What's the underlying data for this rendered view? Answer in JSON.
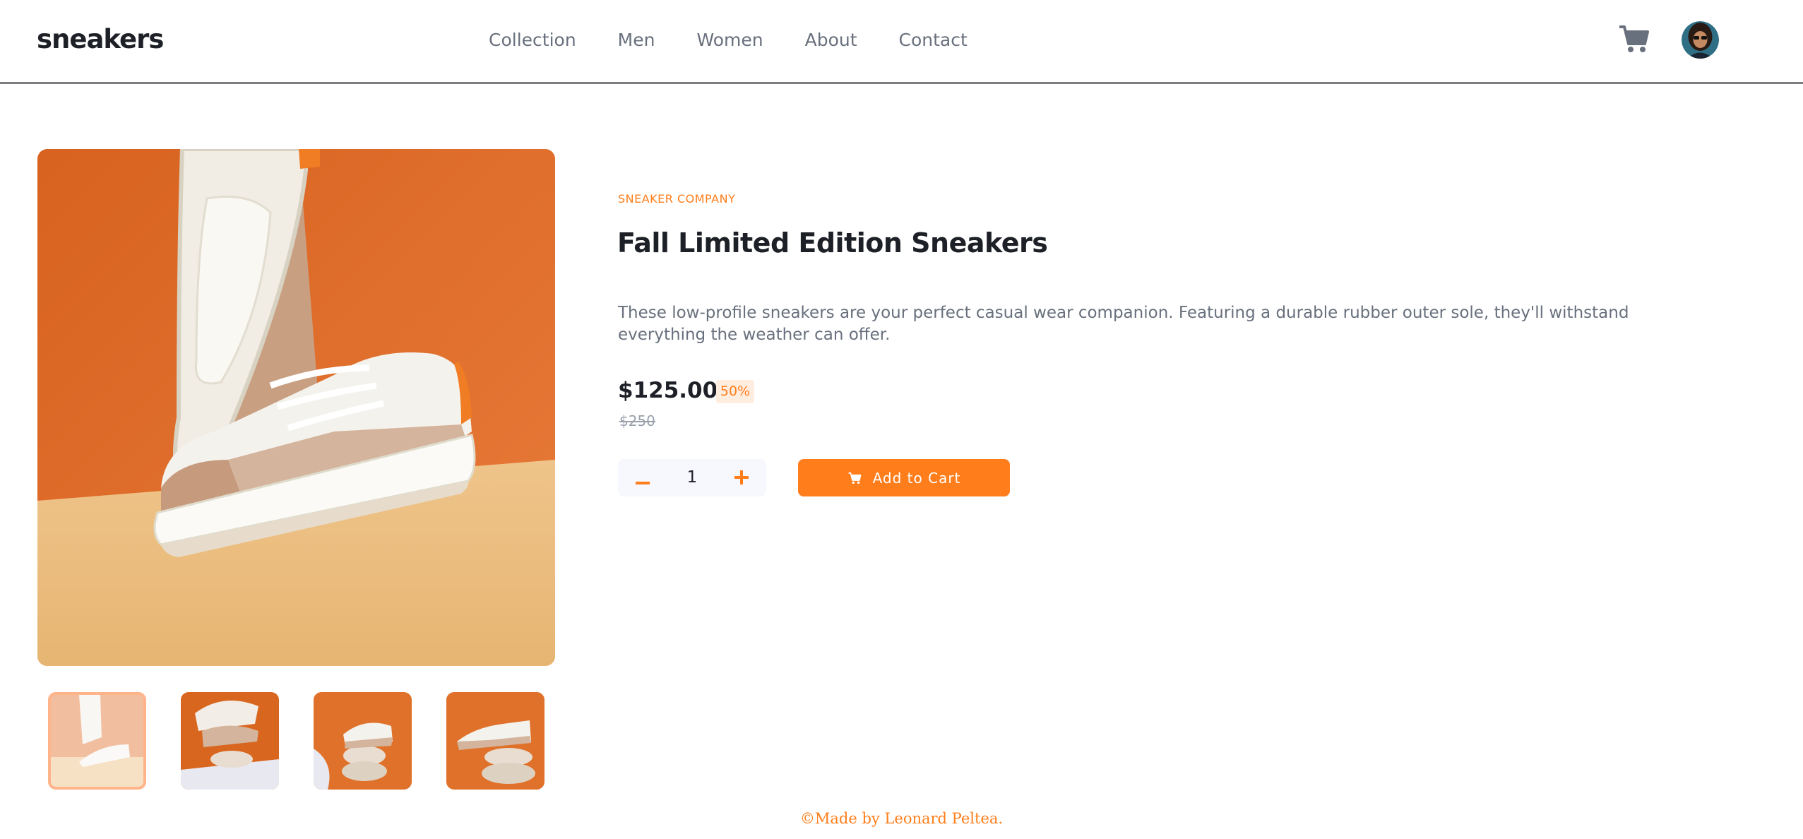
{
  "header": {
    "logo": "sneakers",
    "nav": [
      "Collection",
      "Men",
      "Women",
      "About",
      "Contact"
    ],
    "cart_icon": "cart-icon",
    "avatar_icon": "user-avatar"
  },
  "product": {
    "company": "SNEAKER COMPANY",
    "title": "Fall Limited Edition Sneakers",
    "description": "These low-profile sneakers are your perfect casual wear companion. Featuring a durable rubber outer sole, they'll withstand everything the weather can offer.",
    "price": "$125.00",
    "discount": "50%",
    "old_price": "$250",
    "quantity": "1",
    "minus_icon": "minus-icon",
    "plus_icon": "plus-icon",
    "add_to_cart": "Add to Cart",
    "active_thumbnail": 1
  },
  "footer": {
    "credit": "©Made by Leonard Peltea."
  },
  "colors": {
    "accent": "#ff7d1a",
    "accent_pale": "#ffede0",
    "text_dark": "#1d2026",
    "text_muted": "#68707d",
    "image_orange": "#e0712a",
    "image_floor": "#ecbc7c"
  }
}
